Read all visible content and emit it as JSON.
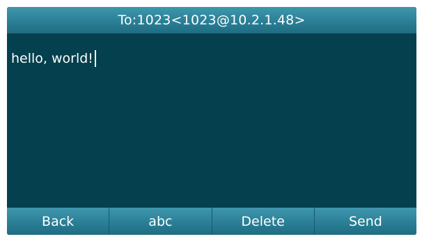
{
  "header": {
    "title": "To:1023<1023@10.2.1.48>"
  },
  "message": {
    "text": "hello, world!"
  },
  "softkeys": [
    {
      "label": "Back"
    },
    {
      "label": "abc"
    },
    {
      "label": "Delete"
    },
    {
      "label": "Send"
    }
  ],
  "colors": {
    "screen_background": "#04404d",
    "bar_top": "#3f97ad",
    "bar_bottom": "#1f6c82",
    "text": "#ffffff"
  }
}
